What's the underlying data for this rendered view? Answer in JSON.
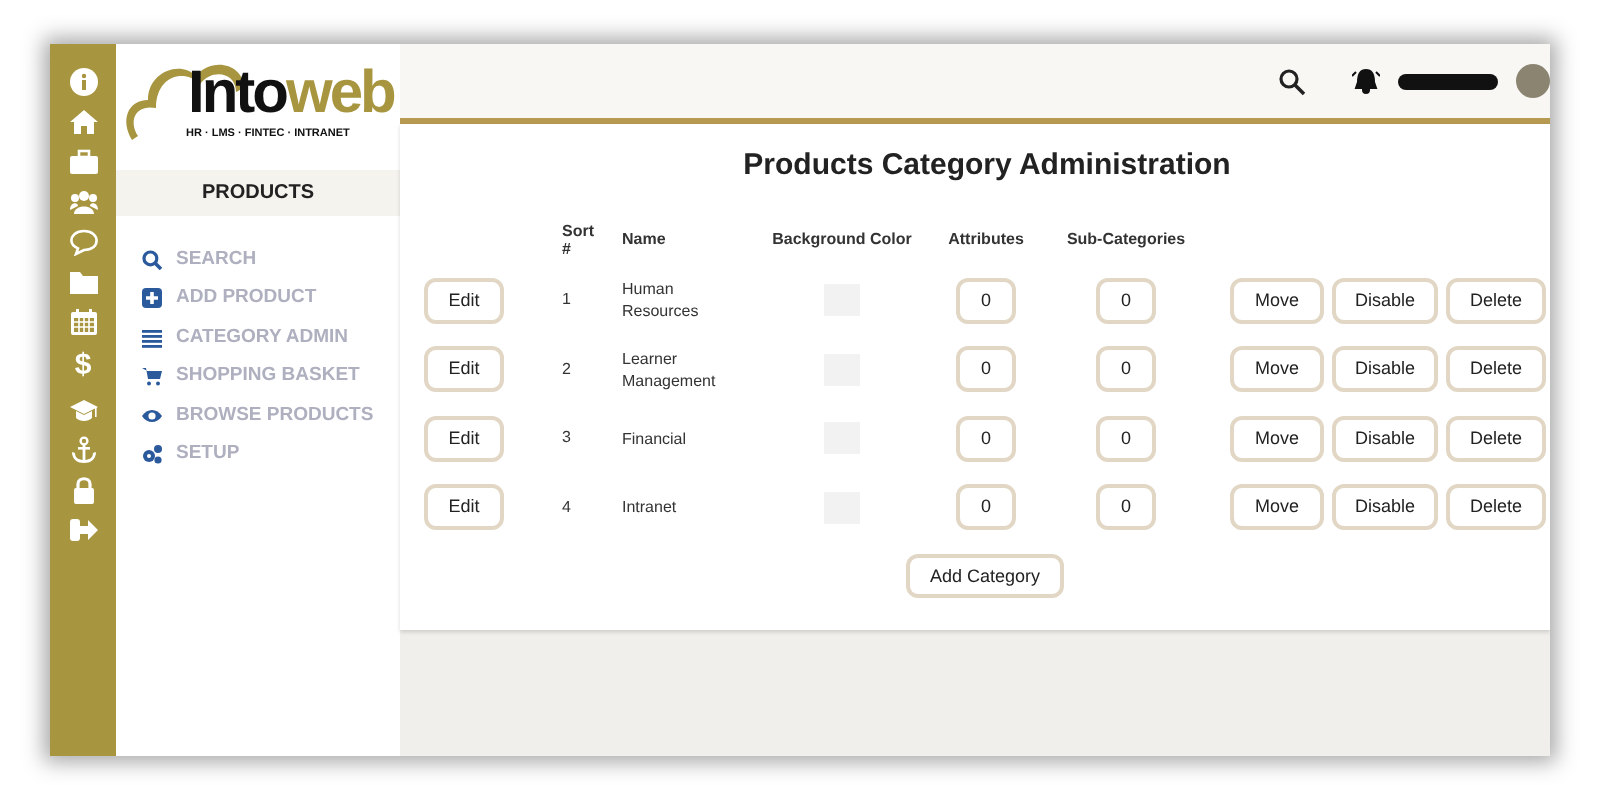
{
  "rail_glyph": "$",
  "logo": {
    "wordmark_dark": "Into",
    "wordmark_accent": "web",
    "tagline": "HR · LMS · FINTEC · INTRANET"
  },
  "sidebar": {
    "heading": "PRODUCTS",
    "items": [
      "SEARCH",
      "ADD PRODUCT",
      "CATEGORY ADMIN",
      "SHOPPING BASKET",
      "BROWSE PRODUCTS",
      "SETUP"
    ]
  },
  "title": "Products Category Administration",
  "table": {
    "columns": [
      "Sort #",
      "Name",
      "Background Color",
      "Attributes",
      "Sub-Categories"
    ],
    "rows": [
      {
        "edit": "Edit",
        "sort": "1",
        "name": "Human Resources",
        "color": "#f2f2f2",
        "attributes": "0",
        "sub_categories": "0",
        "actions": [
          "Move",
          "Disable",
          "Delete"
        ]
      },
      {
        "edit": "Edit",
        "sort": "2",
        "name": "Learner Management",
        "color": "#f2f2f2",
        "attributes": "0",
        "sub_categories": "0",
        "actions": [
          "Move",
          "Disable",
          "Delete"
        ]
      },
      {
        "edit": "Edit",
        "sort": "3",
        "name": "Financial",
        "color": "#f2f2f2",
        "attributes": "0",
        "sub_categories": "0",
        "actions": [
          "Move",
          "Disable",
          "Delete"
        ]
      },
      {
        "edit": "Edit",
        "sort": "4",
        "name": "Intranet",
        "color": "#f2f2f2",
        "attributes": "0",
        "sub_categories": "0",
        "actions": [
          "Move",
          "Disable",
          "Delete"
        ]
      }
    ]
  },
  "add_button": "Add Category"
}
